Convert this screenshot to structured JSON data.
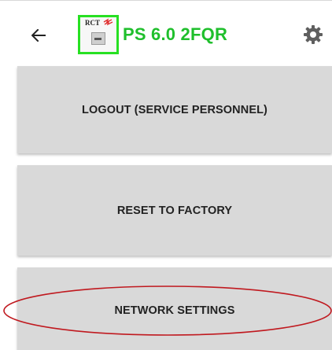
{
  "header": {
    "logo_text": "RCT",
    "title": "PS 6.0 2FQR",
    "back_icon": "arrow-left-icon",
    "settings_icon": "gear-icon",
    "accent_color": "#1fbf2c",
    "logo_border_color": "#27e022"
  },
  "menu": {
    "items": [
      {
        "label": "LOGOUT (SERVICE PERSONNEL)"
      },
      {
        "label": "RESET TO FACTORY"
      },
      {
        "label": "NETWORK SETTINGS"
      }
    ]
  },
  "annotation": {
    "shape": "ellipse",
    "color": "#c0191f",
    "target": "NETWORK SETTINGS"
  }
}
